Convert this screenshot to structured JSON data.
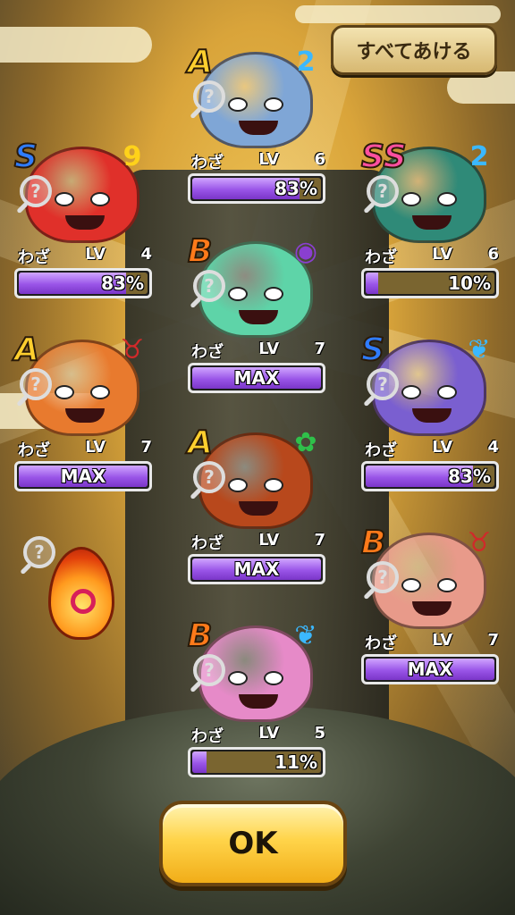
{
  "top_button": "すべてあける",
  "ok_button": "OK",
  "level_label": "わざ",
  "lv_label": "LV",
  "colors": {
    "rank_a": "#ffcf2e",
    "rank_b": "#ff7a1a",
    "rank_s": "#2f7cff",
    "rank_ss": "#ff4fa0",
    "bar_fill": "#9a55e8",
    "bar_track": "#7a6530"
  },
  "cards": [
    {
      "rank": "A",
      "tribe": "2",
      "tribe_color": "#3bb8ff",
      "level": "6",
      "progress_text": "83%",
      "progress": 0.83,
      "face_color": "#7fa6d6",
      "icon": "shark-yokai-icon"
    },
    {
      "rank": "S",
      "tribe": "9",
      "tribe_color": "#ffd21a",
      "level": "4",
      "progress_text": "83%",
      "progress": 0.83,
      "face_color": "#e0302a",
      "icon": "red-bird-yokai-icon"
    },
    {
      "rank": "SS",
      "tribe": "2",
      "tribe_color": "#3bb8ff",
      "level": "6",
      "progress_text": "10%",
      "progress": 0.1,
      "face_color": "#2f8a78",
      "icon": "dragon-yokai-icon"
    },
    {
      "rank": "B",
      "tribe": "eye",
      "tribe_color": "#8a3fd0",
      "level": "7",
      "progress_text": "MAX",
      "progress": 1,
      "face_color": "#5ed4a8",
      "icon": "green-ghost-yokai-icon"
    },
    {
      "rank": "A",
      "tribe": "horns",
      "tribe_color": "#d02a2a",
      "level": "7",
      "progress_text": "MAX",
      "progress": 1,
      "face_color": "#e87a2e",
      "icon": "armored-yokai-icon"
    },
    {
      "rank": "S",
      "tribe": "drop",
      "tribe_color": "#3bb8ff",
      "level": "4",
      "progress_text": "83%",
      "progress": 0.83,
      "face_color": "#7a5fd0",
      "icon": "starry-yokai-icon"
    },
    {
      "rank": "A",
      "tribe": "clover",
      "tribe_color": "#2fc04a",
      "level": "7",
      "progress_text": "MAX",
      "progress": 1,
      "face_color": "#b8481c",
      "icon": "oni-yokai-icon"
    },
    {
      "rank": "B",
      "tribe": "horns",
      "tribe_color": "#d02a2a",
      "level": "7",
      "progress_text": "MAX",
      "progress": 1,
      "face_color": "#e89a8a",
      "icon": "pig-yokai-icon"
    },
    {
      "rank": "B",
      "tribe": "drop",
      "tribe_color": "#3bb8ff",
      "level": "5",
      "progress_text": "11%",
      "progress": 0.11,
      "face_color": "#e68ac8",
      "icon": "clam-yokai-icon"
    }
  ]
}
